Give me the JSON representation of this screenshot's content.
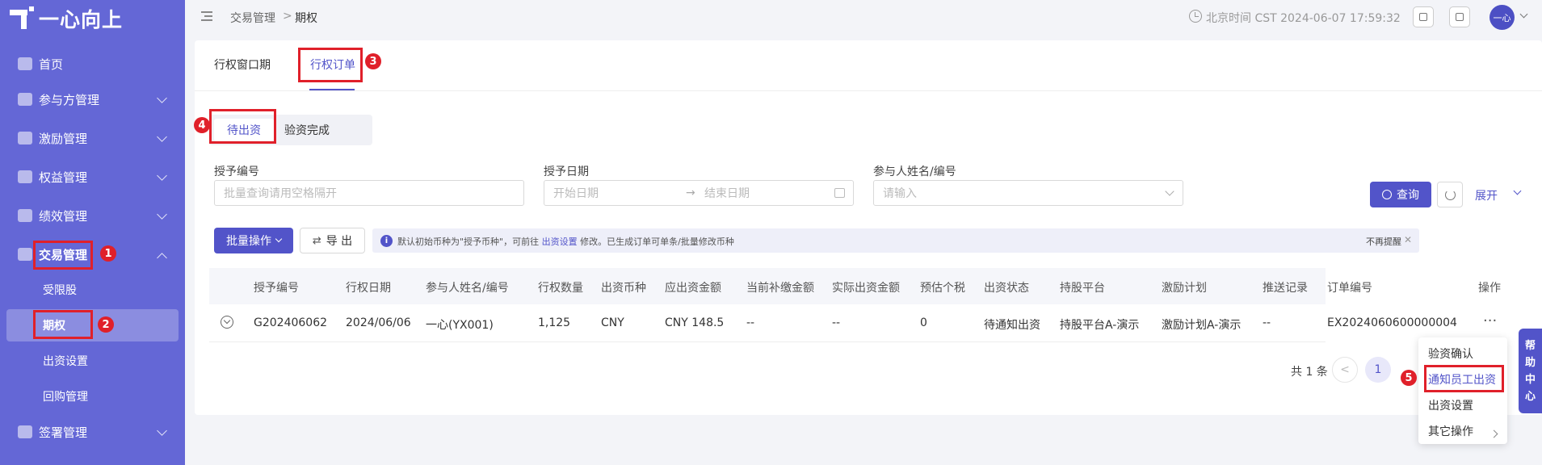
{
  "app": {
    "logo_text": "一心向上"
  },
  "sidebar": {
    "items": [
      {
        "label": "首页",
        "icon": "home-icon"
      },
      {
        "label": "参与方管理",
        "icon": "participants-icon"
      },
      {
        "label": "激励管理",
        "icon": "incentive-icon"
      },
      {
        "label": "权益管理",
        "icon": "equity-icon"
      },
      {
        "label": "绩效管理",
        "icon": "performance-icon"
      },
      {
        "label": "交易管理",
        "icon": "trade-icon",
        "expanded": true
      },
      {
        "label": "签署管理",
        "icon": "sign-icon"
      }
    ],
    "sub_items": [
      {
        "label": "受限股"
      },
      {
        "label": "期权",
        "active": true
      },
      {
        "label": "出资设置"
      },
      {
        "label": "回购管理"
      }
    ]
  },
  "annotations": [
    "1",
    "2",
    "3",
    "4",
    "5"
  ],
  "header": {
    "breadcrumb": [
      "交易管理",
      "期权"
    ],
    "breadcrumb_sep": ">",
    "time": "北京时间 CST 2024-06-07 17:59:32",
    "avatar": "一心"
  },
  "tabs": [
    {
      "label": "行权窗口期"
    },
    {
      "label": "行权订单",
      "active": true
    }
  ],
  "subtabs": [
    {
      "label": "待出资",
      "active": true
    },
    {
      "label": "验资完成"
    }
  ],
  "filters": {
    "grant_no": {
      "label": "授予编号",
      "placeholder": "批量查询请用空格隔开"
    },
    "grant_date": {
      "label": "授予日期",
      "start_placeholder": "开始日期",
      "end_placeholder": "结束日期",
      "arrow": "→"
    },
    "participant": {
      "label": "参与人姓名/编号",
      "placeholder": "请输入"
    },
    "query_label": "查询",
    "expand_label": "展开"
  },
  "toolbar": {
    "batch_label": "批量操作",
    "export_label": "导 出"
  },
  "notice": {
    "text_before": "默认初始币种为\"授予币种\"，可前往 ",
    "link": "出资设置",
    "text_after": " 修改。已生成订单可单条/批量修改币种",
    "dismiss": "不再提醒"
  },
  "table": {
    "columns": [
      "授予编号",
      "行权日期",
      "参与人姓名/编号",
      "行权数量",
      "出资币种",
      "应出资金额",
      "当前补缴金额",
      "实际出资金额",
      "预估个税",
      "出资状态",
      "持股平台",
      "激励计划",
      "推送记录",
      "订单编号",
      "操作"
    ],
    "rows": [
      [
        "G202406062",
        "2024/06/06",
        "一心(YX001)",
        "1,125",
        "CNY",
        "CNY 148.5",
        "--",
        "--",
        "0",
        "待通知出资",
        "持股平台A-演示",
        "激励计划A-演示",
        "--",
        "EX2024060600000004",
        "···"
      ]
    ]
  },
  "pagination": {
    "total": "共 1 条",
    "current": "1",
    "prev": "<"
  },
  "dropdown": {
    "items": [
      {
        "label": "验资确认"
      },
      {
        "label": "通知员工出资",
        "highlighted": true
      },
      {
        "label": "出资设置"
      },
      {
        "label": "其它操作"
      }
    ]
  },
  "help": [
    "帮",
    "助",
    "中",
    "心"
  ],
  "colors": {
    "primary": "#5254c9",
    "sidebar": "#6467d6",
    "annotation": "#e0202a"
  }
}
